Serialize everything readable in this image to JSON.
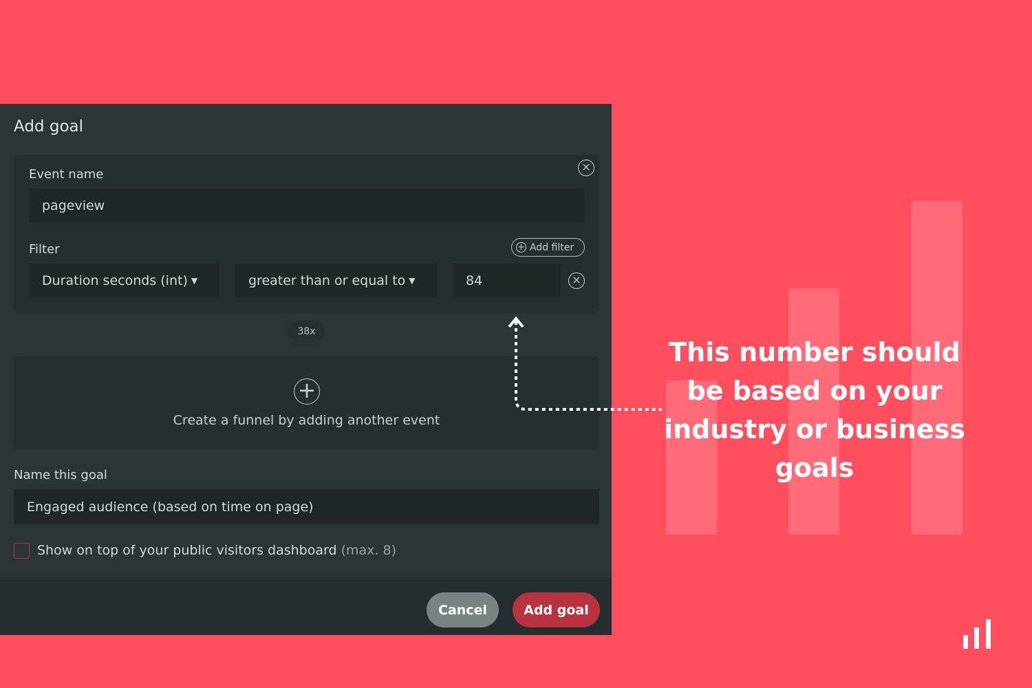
{
  "dialog": {
    "title": "Add goal",
    "event_name_label": "Event name",
    "event_name_value": "pageview",
    "filter_label": "Filter",
    "add_filter_label": "Add filter",
    "filter_property": "Duration seconds (int)",
    "filter_operator": "greater than or equal to",
    "filter_value": "84",
    "count_badge": "38x",
    "funnel_text": "Create a funnel by adding another event",
    "goal_name_label": "Name this goal",
    "goal_name_value": "Engaged audience (based on time on page)",
    "show_on_top_label": "Show on top of your public visitors dashboard",
    "show_on_top_hint": "(max. 8)",
    "show_on_top_checked": false,
    "cancel_label": "Cancel",
    "submit_label": "Add goal"
  },
  "annotation": {
    "text": "This number should be based on your industry or business goals"
  },
  "colors": {
    "background": "#ff4f5e",
    "dialog": "#2a3537",
    "primary_button": "#b8333e",
    "cancel_button": "#7b8282"
  }
}
